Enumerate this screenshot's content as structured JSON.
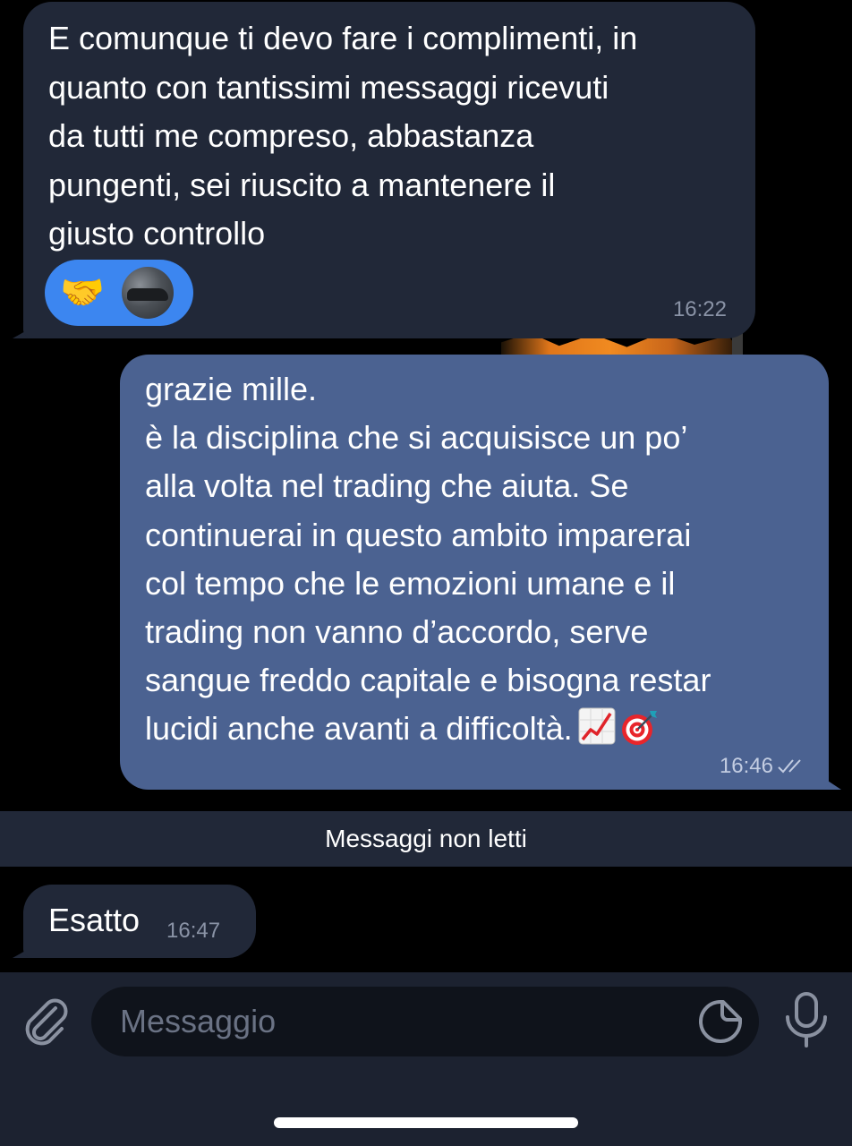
{
  "messages": {
    "incoming_1": {
      "text": "E comunque ti devo fare i complimenti, in\nquanto con tantissimi messaggi ricevuti\nda tutti me compreso, abbastanza\npungenti, sei riuscito a mantenere il\ngiusto controllo",
      "reaction_emoji": "🤝",
      "time": "16:22"
    },
    "outgoing": {
      "text": "grazie mille.\nè la disciplina che si acquisisce un po’\nalla volta nel trading che aiuta. Se\ncontinuerai in questo ambito imparerai\ncol tempo che le emozioni umane e il\ntrading non vanno d’accordo, serve\nsangue freddo capitale e bisogna restar\nlucidi anche avanti a difficoltà.",
      "emojis": [
        "chart-increasing-icon",
        "direct-hit-icon"
      ],
      "time": "16:46",
      "status": "read"
    },
    "incoming_2": {
      "text": "Esatto",
      "time": "16:47"
    }
  },
  "unread_divider": "Messaggi non letti",
  "composer": {
    "placeholder": "Messaggio"
  },
  "colors": {
    "background": "#000000",
    "incoming_bubble": "#212838",
    "outgoing_bubble": "#4b6291",
    "reaction_pill": "#3c86f0",
    "input_bar": "#1c2230"
  }
}
